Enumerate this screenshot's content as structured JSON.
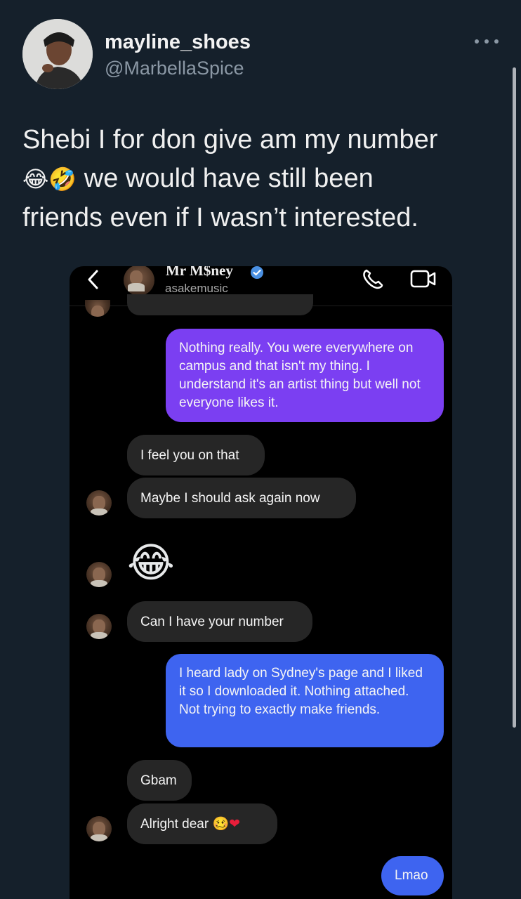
{
  "tweet": {
    "display_name": "mayline_shoes",
    "handle": "@MarbellaSpice",
    "text_line1": "Shebi I for don give am my number",
    "text_emojis": "😂🤣",
    "text_line2_rest": " we would have still been",
    "text_line3": "friends even if I wasn’t interested."
  },
  "dm": {
    "contact_name": "Mr M$ney",
    "contact_username": "asakemusic",
    "messages": [
      {
        "dir": "out",
        "text": "Nothing really. You were everywhere on campus and that isn't my thing. I understand it's an artist thing but well not everyone likes it."
      },
      {
        "dir": "in",
        "text": "I feel you on that"
      },
      {
        "dir": "in",
        "text": "Maybe I should ask again now"
      },
      {
        "dir": "in",
        "text": "😂"
      },
      {
        "dir": "in",
        "text": "Can I have your number"
      },
      {
        "dir": "out",
        "text": "I heard lady on Sydney's page and I liked it so I downloaded it. Nothing attached. Not trying to exactly make friends."
      },
      {
        "dir": "in",
        "text": "Gbam"
      },
      {
        "dir": "in",
        "text": "Alright dear",
        "emoji": "🥴",
        "heart": "❤"
      },
      {
        "dir": "out",
        "text": "Lmao"
      }
    ]
  },
  "colors": {
    "background": "#15202b",
    "incoming_bubble": "#262626",
    "outgoing_purple": "#7b3ff2",
    "outgoing_blue": "#3e64f0",
    "verified": "#4a90e2"
  },
  "icons": [
    "more-options-icon",
    "back-arrow-icon",
    "verified-badge-icon",
    "phone-call-icon",
    "video-call-icon"
  ]
}
